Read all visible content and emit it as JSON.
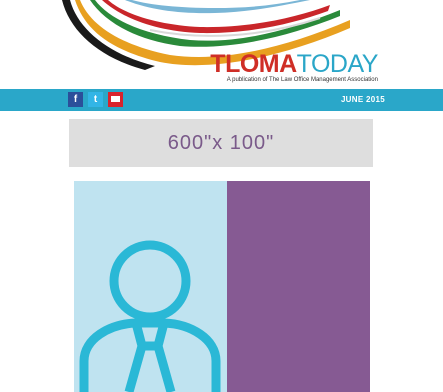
{
  "header": {
    "brand_part1": "TLOMA",
    "brand_part2": "TODAY",
    "tagline": "A publication of The Law Office Management Association"
  },
  "share_bar": {
    "facebook_label": "f",
    "twitter_label": "t",
    "issue_date": "JUNE 2015",
    "color": "#2aa7c9"
  },
  "ad_banner": {
    "label": "600\"x 100\""
  },
  "colors": {
    "brand_red": "#cf2e26",
    "brand_blue": "#2aa6c8",
    "hero_light_blue": "#bfe3f0",
    "hero_purple": "#865a93"
  },
  "icons": [
    "logo-swoosh",
    "facebook-icon",
    "twitter-icon",
    "email-icon",
    "person-icon"
  ]
}
